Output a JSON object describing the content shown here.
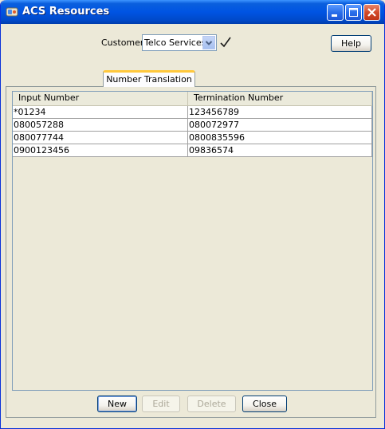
{
  "window": {
    "title": "ACS Resources"
  },
  "customer": {
    "label": "Customer",
    "selected": "Telco Services"
  },
  "help_label": "Help",
  "tab": {
    "label": "Number Translation"
  },
  "table": {
    "columns": [
      "Input Number",
      "Termination Number"
    ],
    "rows": [
      [
        "*01234",
        "123456789"
      ],
      [
        "080057288",
        "080072977"
      ],
      [
        "080077744",
        "0800835596"
      ],
      [
        "0900123456",
        "09836574"
      ]
    ]
  },
  "buttons": {
    "new": "New",
    "edit": "Edit",
    "delete": "Delete",
    "close": "Close"
  },
  "colors": {
    "titlebar": "#0054e3",
    "tab_accent": "#ffc83c",
    "window_bg": "#ece9d8"
  },
  "icons": [
    "app-icon",
    "minimize-icon",
    "maximize-icon",
    "close-icon",
    "chevron-down-icon",
    "checkmark-icon"
  ]
}
